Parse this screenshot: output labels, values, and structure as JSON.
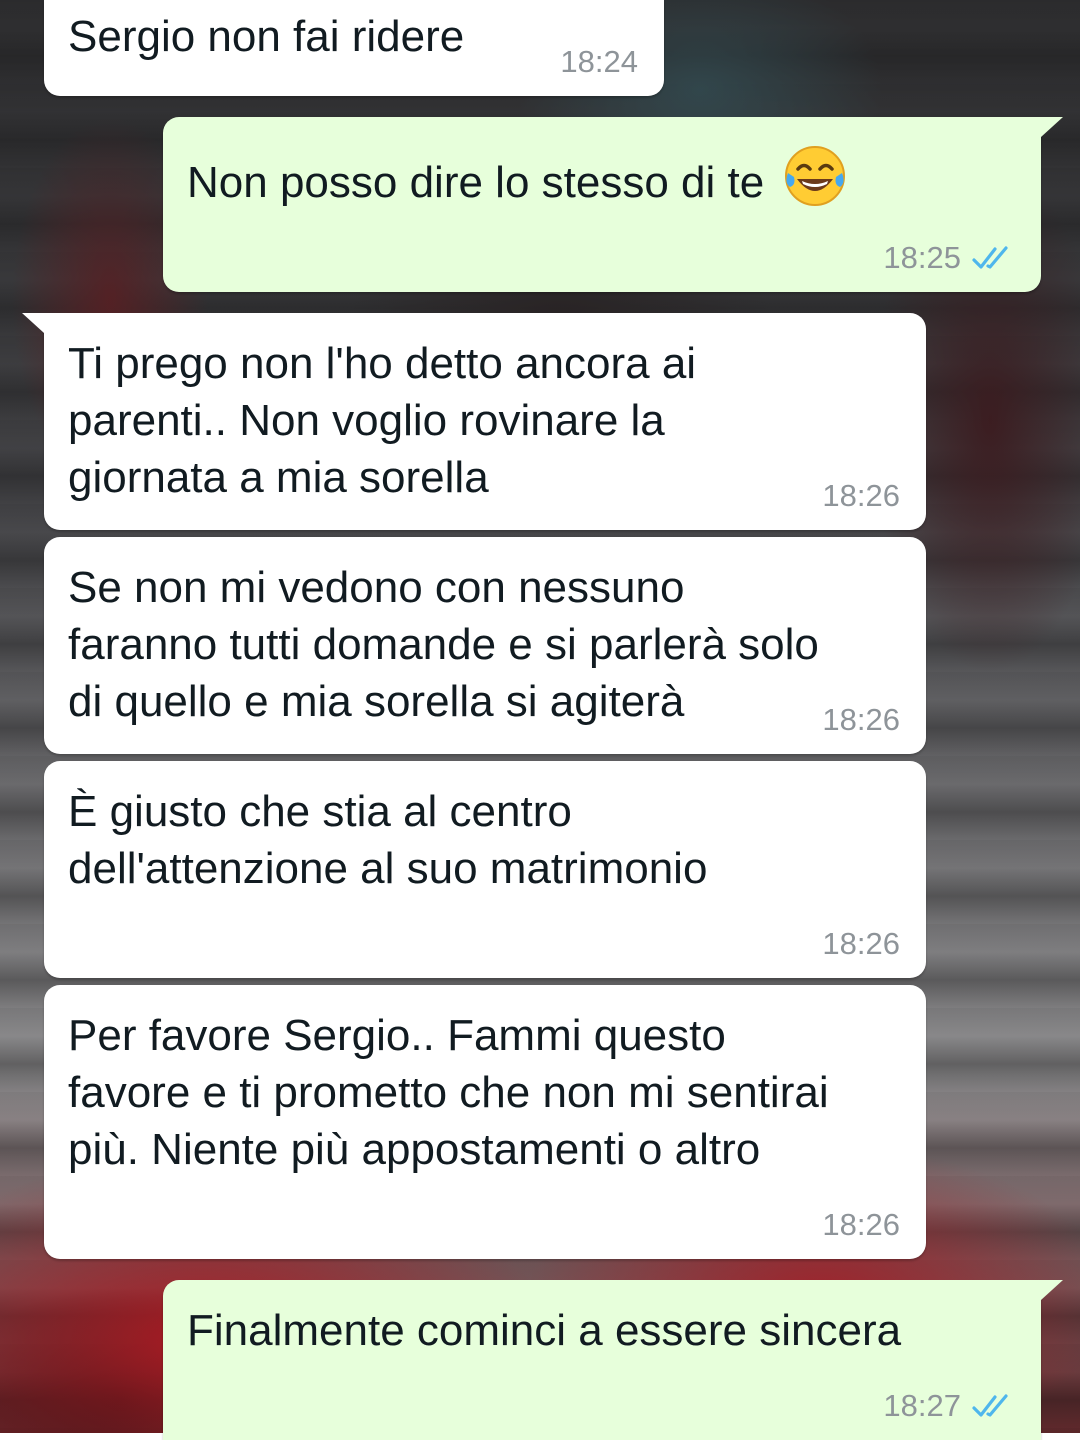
{
  "theme": {
    "incoming_bubble": "#ffffff",
    "outgoing_bubble": "#e7ffdb",
    "text": "#111b21",
    "meta_text": "#8e9499",
    "read_ticks": "#4fb6ec"
  },
  "messages": [
    {
      "direction": "incoming",
      "text": "Sergio non fai ridere",
      "time": "18:24"
    },
    {
      "direction": "outgoing",
      "text": "Non posso dire lo stesso di te",
      "emoji": "face-with-tears-of-joy",
      "time": "18:25",
      "status": "read"
    },
    {
      "direction": "incoming",
      "text": "Ti prego non l'ho detto ancora ai\nparenti.. Non voglio rovinare la\ngiornata a mia sorella",
      "time": "18:26"
    },
    {
      "direction": "incoming",
      "text": "Se non mi vedono con nessuno\nfaranno tutti domande e si parlerà solo\ndi quello e mia sorella si agiterà",
      "time": "18:26"
    },
    {
      "direction": "incoming",
      "text": "È giusto che stia al centro\ndell'attenzione al suo matrimonio",
      "time": "18:26"
    },
    {
      "direction": "incoming",
      "text": "Per favore Sergio.. Fammi questo\nfavore e ti prometto che non mi sentirai\npiù. Niente più appostamenti o altro",
      "time": "18:26"
    },
    {
      "direction": "outgoing",
      "text": "Finalmente cominci a essere sincera",
      "time": "18:27",
      "status": "read"
    }
  ]
}
